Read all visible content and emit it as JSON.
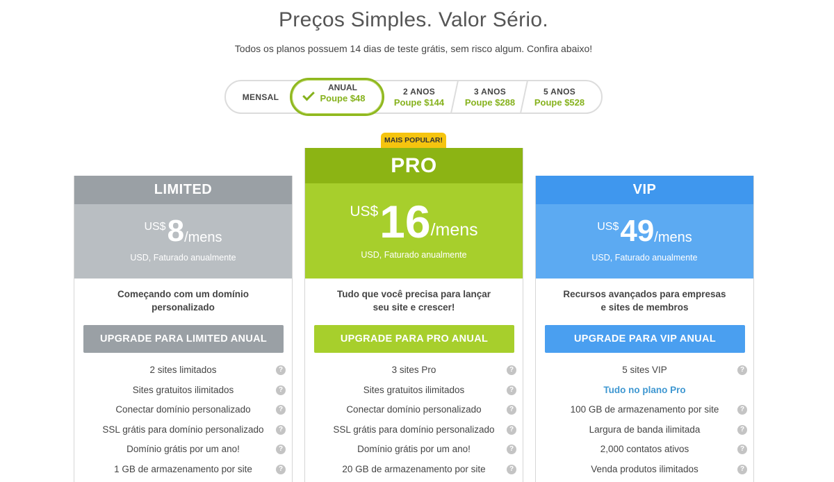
{
  "header": {
    "title": "Preços Simples. Valor Sério.",
    "subtitle": "Todos os planos possuem 14 dias de teste grátis, sem risco algum. Confira abaixo!"
  },
  "billing_toggle": {
    "options": [
      {
        "name": "MENSAL",
        "save": ""
      },
      {
        "name": "ANUAL",
        "save": "Poupe $48",
        "selected": true
      },
      {
        "name": "2 ANOS",
        "save": "Poupe $144"
      },
      {
        "name": "3 ANOS",
        "save": "Poupe $288"
      },
      {
        "name": "5 ANOS",
        "save": "Poupe $528"
      }
    ]
  },
  "badge": "MAIS POPULAR!",
  "plans": {
    "limited": {
      "name": "LIMITED",
      "currency": "US$",
      "price": "8",
      "period": "/mens",
      "billed": "USD, Faturado anualmente",
      "desc": "Começando com um domínio personalizado",
      "button": "UPGRADE PARA LIMITED ANUAL",
      "features": [
        "2 sites limitados",
        "Sites gratuitos ilimitados",
        "Conectar domínio personalizado",
        "SSL grátis para domínio personalizado",
        "Domínio grátis por um ano!",
        "1 GB de armazenamento por site"
      ]
    },
    "pro": {
      "name": "PRO",
      "currency": "US$",
      "price": "16",
      "period": "/mens",
      "billed": "USD, Faturado anualmente",
      "desc": "Tudo que você precisa para lançar seu site e crescer!",
      "button": "UPGRADE PARA PRO ANUAL",
      "features": [
        "3 sites Pro",
        "Sites gratuitos ilimitados",
        "Conectar domínio personalizado",
        "SSL grátis para domínio personalizado",
        "Domínio grátis por um ano!",
        "20 GB de armazenamento por site"
      ]
    },
    "vip": {
      "name": "VIP",
      "currency": "US$",
      "price": "49",
      "period": "/mens",
      "billed": "USD, Faturado anualmente",
      "desc": "Recursos avançados para empresas e sites de membros",
      "button": "UPGRADE PARA VIP ANUAL",
      "features": [
        "5 sites VIP",
        "Tudo no plano Pro",
        "100 GB de armazenamento por site",
        "Largura de banda ilimitada",
        "2,000 contatos ativos",
        "Venda produtos ilimitados"
      ]
    }
  },
  "colors": {
    "limited_head": "#9aa0a5",
    "limited_body": "#b9bec2",
    "pro_head": "#8cb414",
    "pro_body": "#a7cf2c",
    "vip_head": "#3f97ee",
    "vip_body": "#5caaf2",
    "accent_green": "#86b21d",
    "badge": "#f5c40f"
  },
  "icons": {
    "help": "?"
  }
}
